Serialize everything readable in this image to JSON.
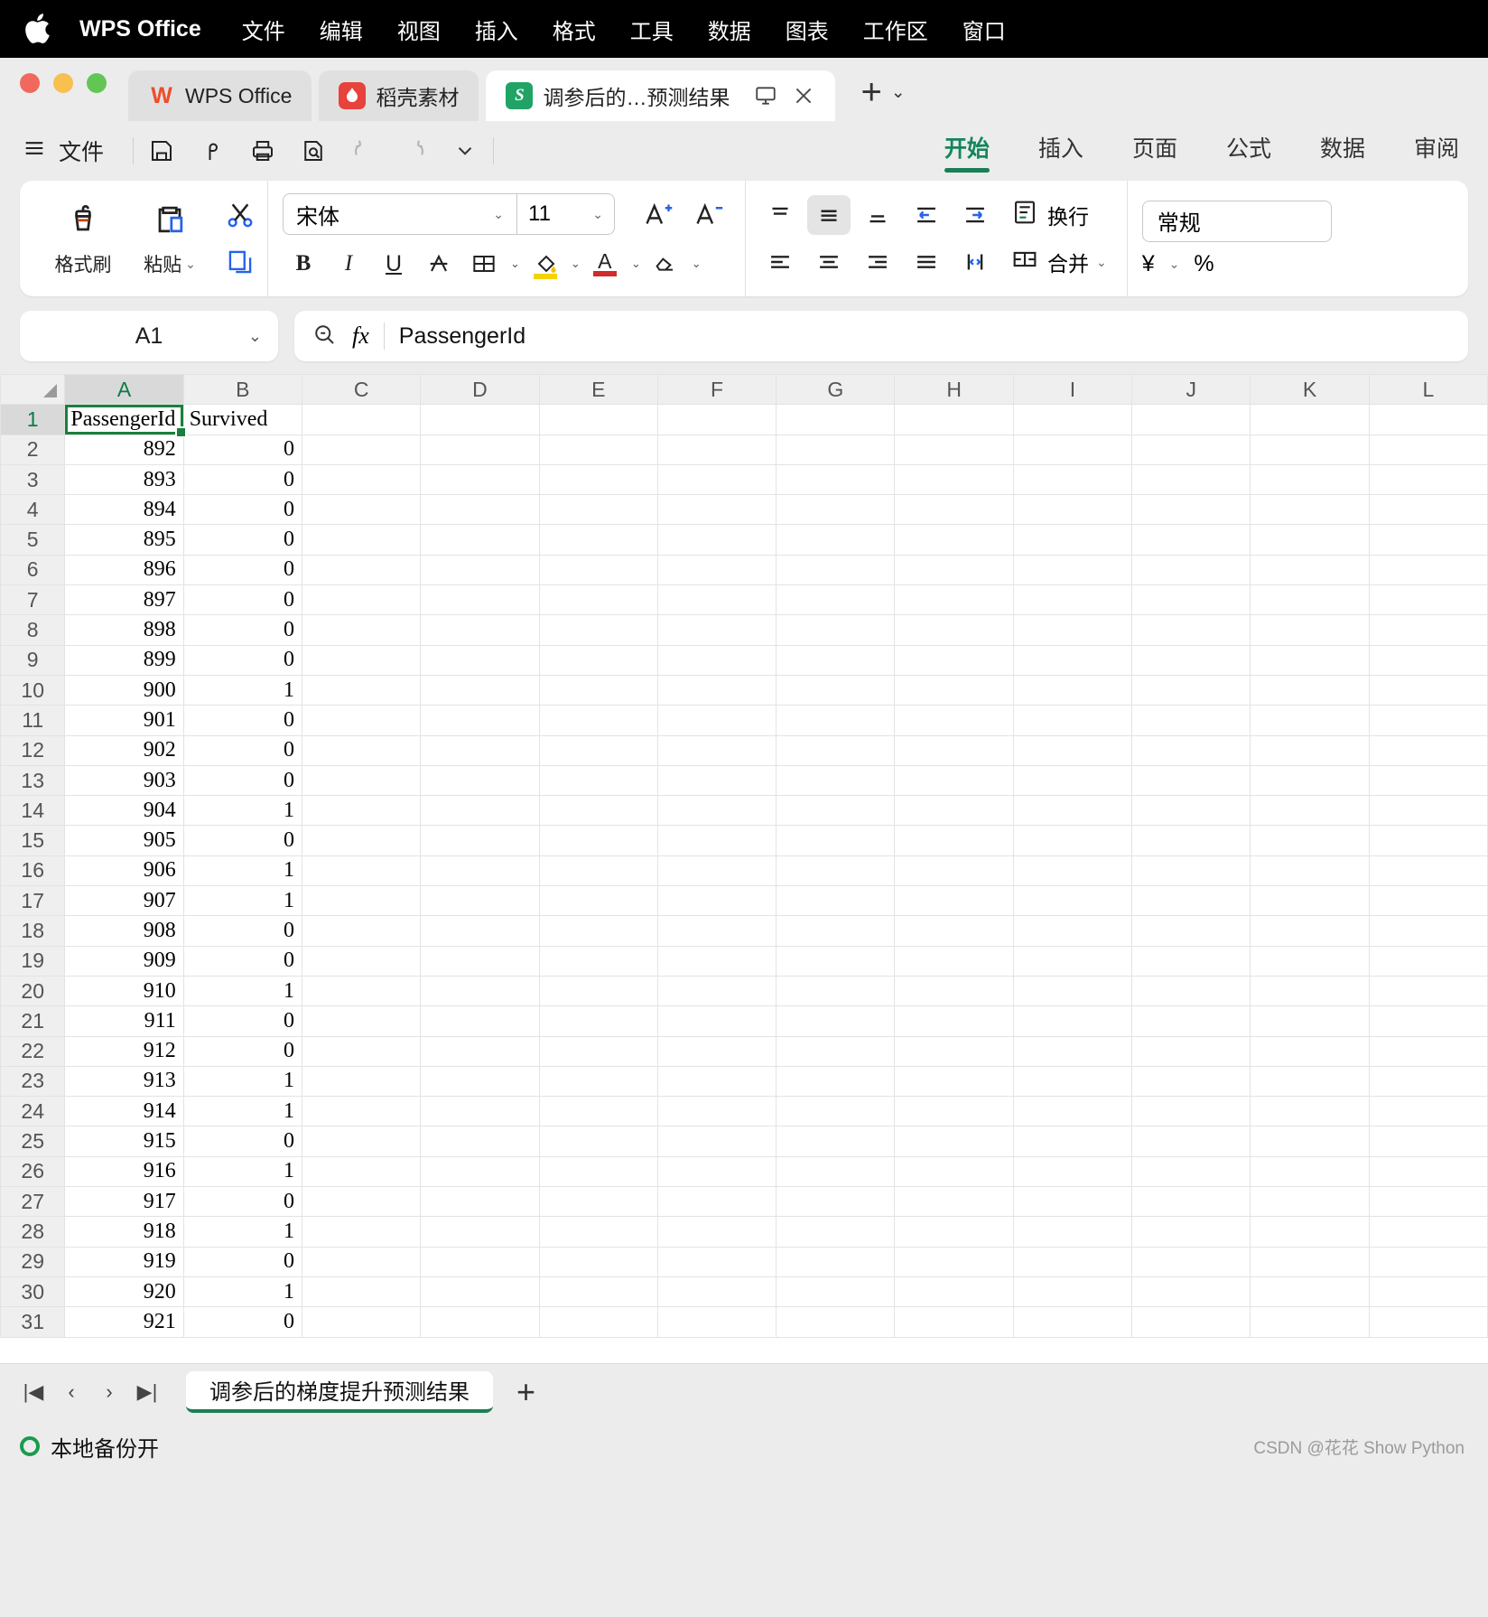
{
  "macmenu": {
    "apple_icon": "apple-logo",
    "items": [
      "WPS Office",
      "文件",
      "编辑",
      "视图",
      "插入",
      "格式",
      "工具",
      "数据",
      "图表",
      "工作区",
      "窗口"
    ]
  },
  "tabs": [
    {
      "label": "WPS Office",
      "icon": "wps-logo-icon",
      "active": false
    },
    {
      "label": "稻壳素材",
      "icon": "docer-icon",
      "active": false
    },
    {
      "label": "调参后的…预测结果",
      "icon": "spreadsheet-icon",
      "active": true
    }
  ],
  "tab_controls": {
    "present_icon": "monitor-icon",
    "close_icon": "close-icon",
    "new_tab": "+",
    "new_tab_caret": "⌄"
  },
  "quick_access": {
    "menu_icon": "hamburger-icon",
    "file_label": "文件",
    "icons": [
      "save-icon",
      "cloud-save-icon",
      "print-icon",
      "print-preview-icon",
      "undo-icon",
      "redo-icon",
      "more-chevron-icon"
    ]
  },
  "ribbon_tabs": [
    {
      "label": "开始",
      "active": true
    },
    {
      "label": "插入",
      "active": false
    },
    {
      "label": "页面",
      "active": false
    },
    {
      "label": "公式",
      "active": false
    },
    {
      "label": "数据",
      "active": false
    },
    {
      "label": "审阅",
      "active": false
    }
  ],
  "ribbon": {
    "format_painter": {
      "label": "格式刷",
      "icon": "format-painter-icon"
    },
    "paste": {
      "label": "粘贴",
      "icon": "paste-icon",
      "caret": "⌄"
    },
    "cut": {
      "icon": "scissors-icon"
    },
    "copy": {
      "icon": "copy-icon"
    },
    "font_name": "宋体",
    "font_size": "11",
    "font_caret": "⌄",
    "bold": "B",
    "italic": "I",
    "underline": "U",
    "strikethrough": "A",
    "borders_icon": "borders-icon",
    "fill_icon": "fill-color-icon",
    "font_color": "A",
    "clear_icon": "eraser-icon",
    "increase_font": "A",
    "decrease_font": "A",
    "wrap_label": "换行",
    "wrap_icon": "wrap-text-icon",
    "merge_label": "合并",
    "merge_icon": "merge-cells-icon",
    "number_format": "常规",
    "currency_icon": "¥",
    "percent_icon": "%"
  },
  "formula_bar": {
    "name_box": "A1",
    "name_caret": "⌄",
    "search_icon": "zoom-out-icon",
    "fx": "fx",
    "content": "PassengerId"
  },
  "sheet": {
    "columns": [
      "A",
      "B",
      "C",
      "D",
      "E",
      "F",
      "G",
      "H",
      "I",
      "J",
      "K",
      "L"
    ],
    "selected_column": "A",
    "selected_row": 1,
    "selected_cell": "A1",
    "headers": {
      "a": "PassengerId",
      "b": "Survived"
    },
    "rows": [
      {
        "n": 1,
        "a": "PassengerId",
        "b": "Survived",
        "header": true
      },
      {
        "n": 2,
        "a": "892",
        "b": "0"
      },
      {
        "n": 3,
        "a": "893",
        "b": "0"
      },
      {
        "n": 4,
        "a": "894",
        "b": "0"
      },
      {
        "n": 5,
        "a": "895",
        "b": "0"
      },
      {
        "n": 6,
        "a": "896",
        "b": "0"
      },
      {
        "n": 7,
        "a": "897",
        "b": "0"
      },
      {
        "n": 8,
        "a": "898",
        "b": "0"
      },
      {
        "n": 9,
        "a": "899",
        "b": "0"
      },
      {
        "n": 10,
        "a": "900",
        "b": "1"
      },
      {
        "n": 11,
        "a": "901",
        "b": "0"
      },
      {
        "n": 12,
        "a": "902",
        "b": "0"
      },
      {
        "n": 13,
        "a": "903",
        "b": "0"
      },
      {
        "n": 14,
        "a": "904",
        "b": "1"
      },
      {
        "n": 15,
        "a": "905",
        "b": "0"
      },
      {
        "n": 16,
        "a": "906",
        "b": "1"
      },
      {
        "n": 17,
        "a": "907",
        "b": "1"
      },
      {
        "n": 18,
        "a": "908",
        "b": "0"
      },
      {
        "n": 19,
        "a": "909",
        "b": "0"
      },
      {
        "n": 20,
        "a": "910",
        "b": "1"
      },
      {
        "n": 21,
        "a": "911",
        "b": "0"
      },
      {
        "n": 22,
        "a": "912",
        "b": "0"
      },
      {
        "n": 23,
        "a": "913",
        "b": "1"
      },
      {
        "n": 24,
        "a": "914",
        "b": "1"
      },
      {
        "n": 25,
        "a": "915",
        "b": "0"
      },
      {
        "n": 26,
        "a": "916",
        "b": "1"
      },
      {
        "n": 27,
        "a": "917",
        "b": "0"
      },
      {
        "n": 28,
        "a": "918",
        "b": "1"
      },
      {
        "n": 29,
        "a": "919",
        "b": "0"
      },
      {
        "n": 30,
        "a": "920",
        "b": "1"
      },
      {
        "n": 31,
        "a": "921",
        "b": "0"
      }
    ]
  },
  "sheet_bar": {
    "first": "|◀",
    "prev": "‹",
    "next": "›",
    "last": "▶|",
    "sheet_name": "调参后的梯度提升预测结果",
    "add": "+"
  },
  "status_bar": {
    "backup_text": "本地备份开",
    "watermark": "CSDN @花花 Show Python"
  },
  "colors": {
    "accent_green": "#1a7f55",
    "selection_green": "#1a7f3c",
    "tab_active": "#ffffff"
  }
}
